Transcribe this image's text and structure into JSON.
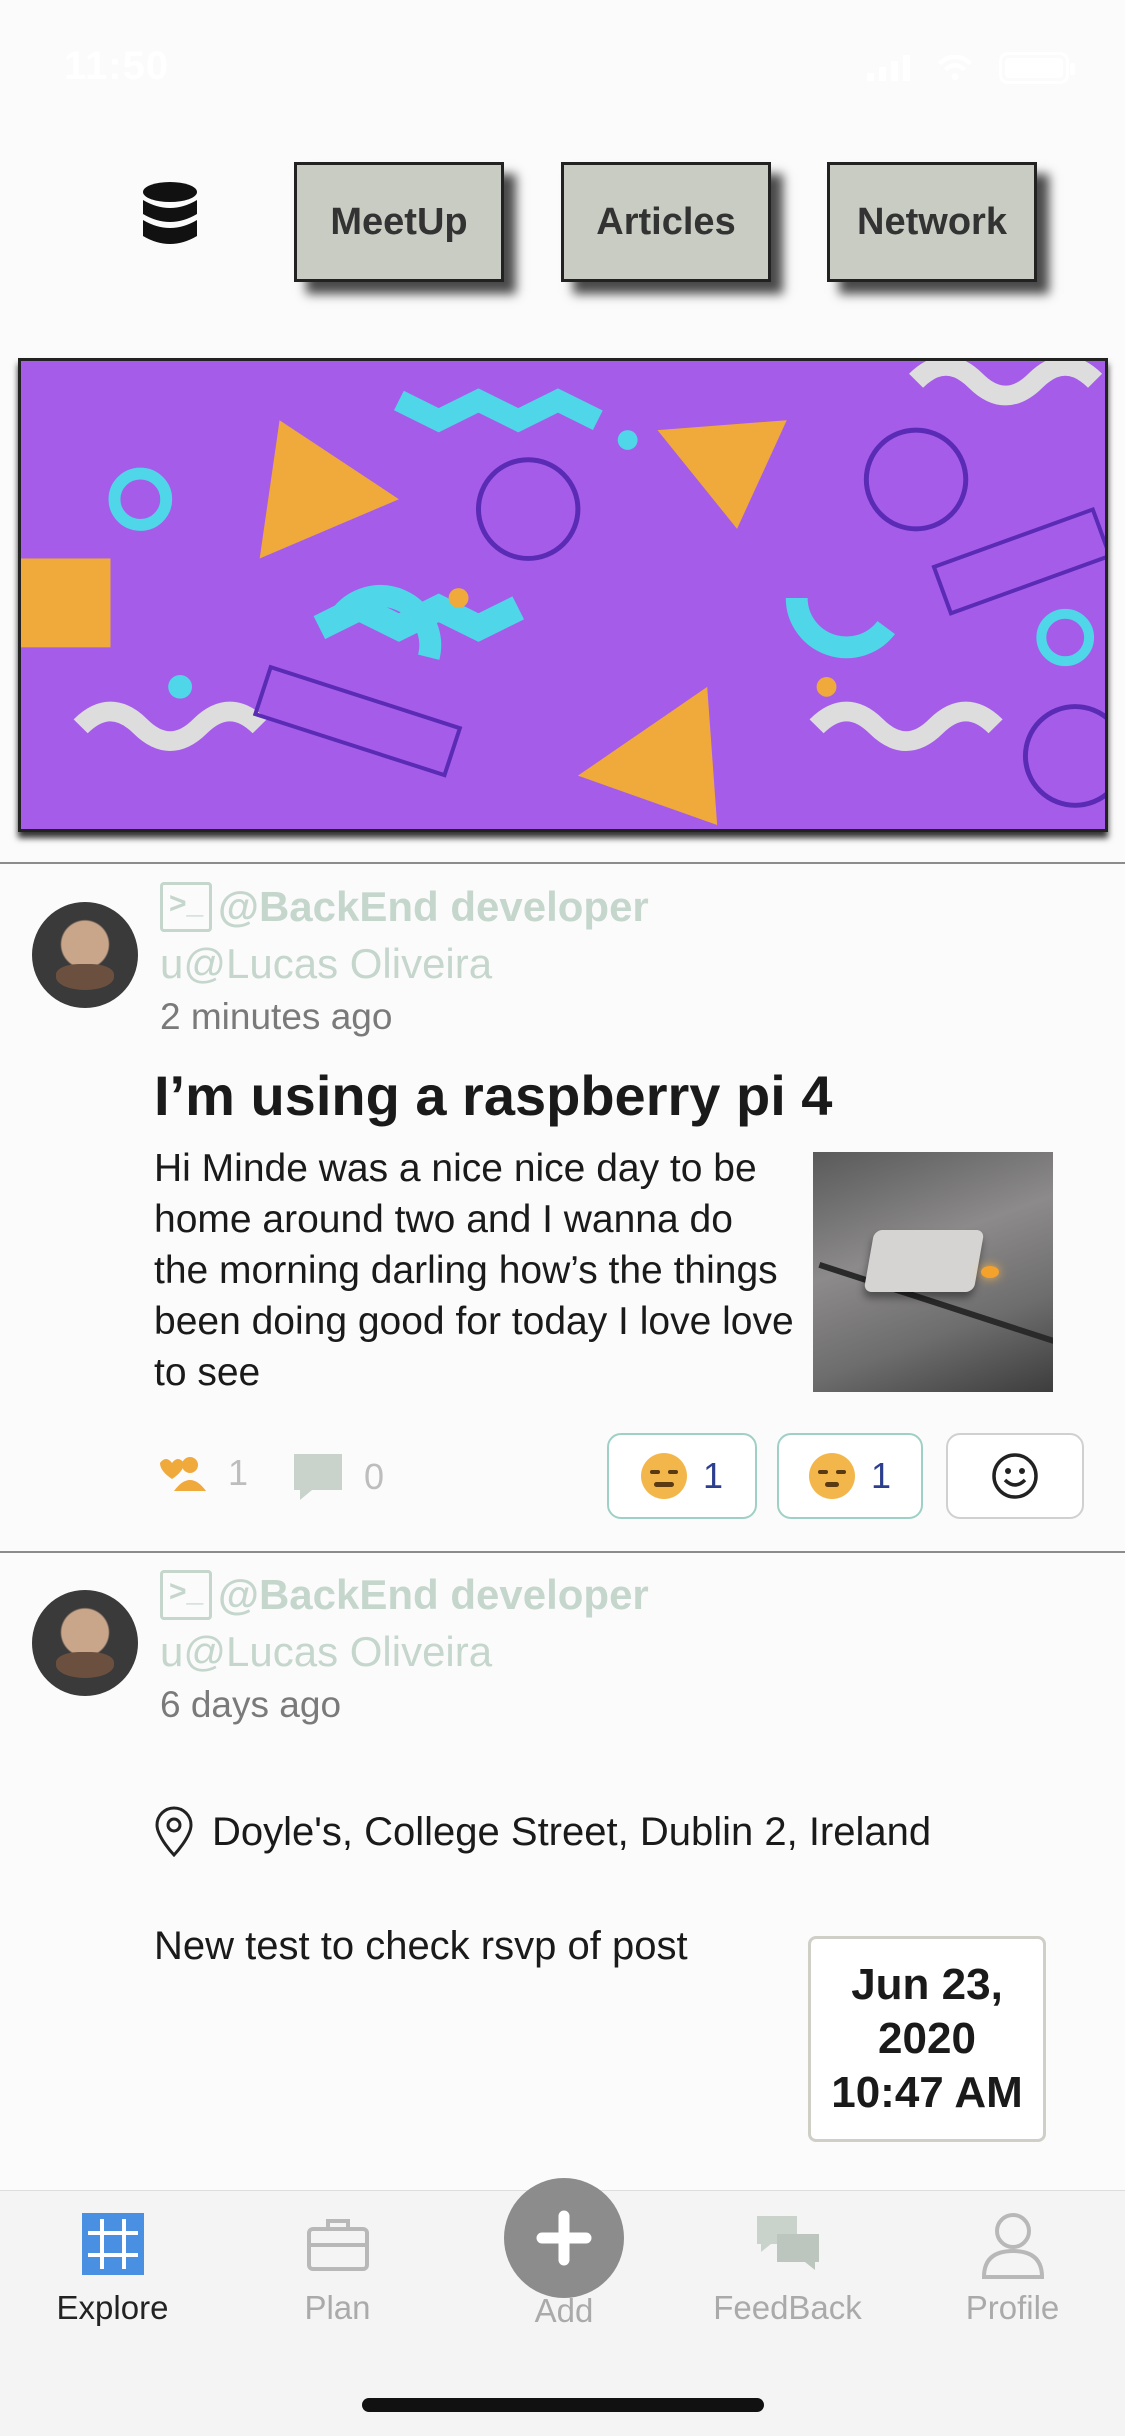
{
  "status_bar": {
    "time": "11:50"
  },
  "top_menu": {
    "meetup": "MeetUp",
    "articles": "Articles",
    "network": "Network"
  },
  "posts": [
    {
      "role": "@BackEnd developer",
      "user": "u@Lucas Oliveira",
      "time": "2 minutes ago",
      "title": "I’m using a raspberry pi 4",
      "body": "Hi Minde was a nice nice day to be home around two and I wanna do the morning darling how’s the things been doing good for today I love love to see",
      "likes": "1",
      "comments": "0",
      "reactions": [
        {
          "count": "1"
        },
        {
          "count": "1"
        }
      ]
    },
    {
      "role": "@BackEnd developer",
      "user": "u@Lucas Oliveira",
      "time": "6 days ago",
      "location": "Doyle's, College Street, Dublin 2, Ireland",
      "text": "New test to check rsvp of post",
      "date_line1": "Jun 23,",
      "date_line2": "2020",
      "date_line3": "10:47 AM"
    }
  ],
  "tab_bar": {
    "explore": "Explore",
    "plan": "Plan",
    "add": "Add",
    "feedback": "FeedBack",
    "profile": "Profile"
  },
  "colors": {
    "menu_button_bg": "#c8ccc3",
    "banner_bg": "#a55ce9",
    "handle_text": "#c5d6cd",
    "explore_active": "#4a90e2"
  },
  "icons": {
    "database": "database-icon",
    "terminal": "terminal-icon",
    "likes": "people-heart-icon",
    "comments": "comment-icon",
    "location": "location-pin-icon",
    "add_reaction": "smiley-icon",
    "explore": "grid-icon",
    "plan": "briefcase-icon",
    "add": "plus-icon",
    "feedback": "chat-bubbles-icon",
    "profile": "person-icon"
  }
}
